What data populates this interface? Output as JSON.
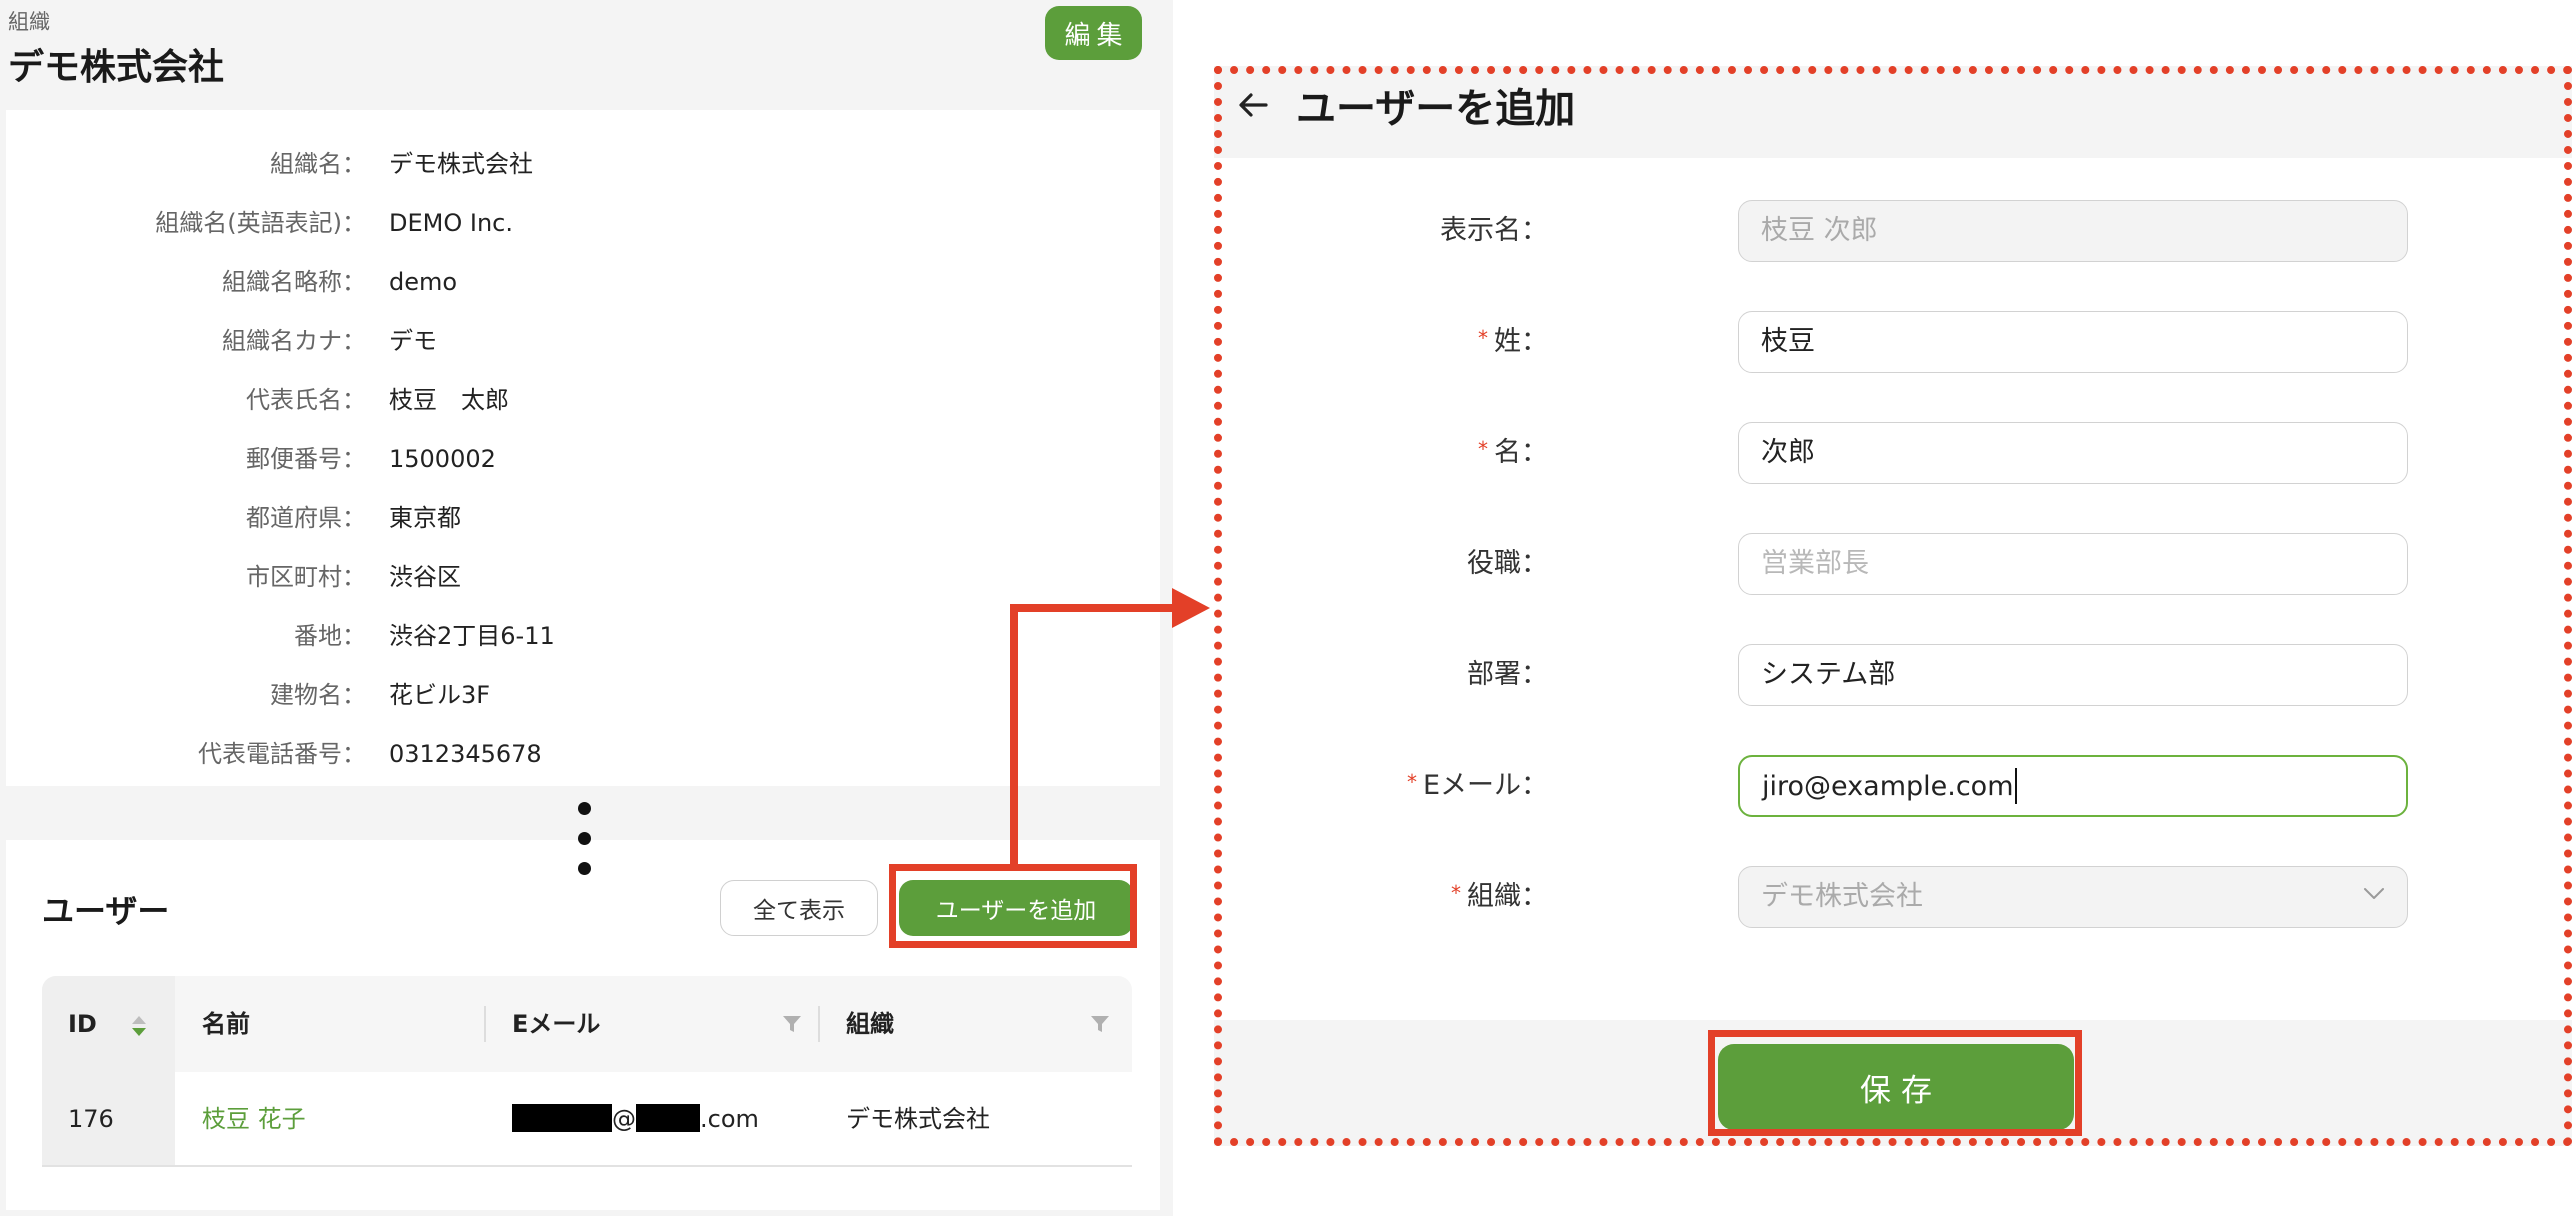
{
  "org": {
    "breadcrumb": "組織",
    "title": "デモ株式会社",
    "edit_label": "編集",
    "fields": [
      {
        "label": "組織名：",
        "value": "デモ株式会社"
      },
      {
        "label": "組織名(英語表記)：",
        "value": "DEMO Inc."
      },
      {
        "label": "組織名略称：",
        "value": "demo"
      },
      {
        "label": "組織名カナ：",
        "value": "デモ"
      },
      {
        "label": "代表氏名：",
        "value": "枝豆　太郎"
      },
      {
        "label": "郵便番号：",
        "value": "1500002"
      },
      {
        "label": "都道府県：",
        "value": "東京都"
      },
      {
        "label": "市区町村：",
        "value": "渋谷区"
      },
      {
        "label": "番地：",
        "value": "渋谷2丁目6-11"
      },
      {
        "label": "建物名：",
        "value": "花ビル3F"
      },
      {
        "label": "代表電話番号：",
        "value": "0312345678"
      }
    ]
  },
  "users": {
    "heading": "ユーザー",
    "show_all_label": "全て表示",
    "add_user_label": "ユーザーを追加",
    "columns": {
      "id": "ID",
      "name": "名前",
      "email": "Eメール",
      "org": "組織"
    },
    "rows": [
      {
        "id": "176",
        "name": "枝豆 花子",
        "email_at": "@",
        "email_tld": "com",
        "org": "デモ株式会社"
      }
    ]
  },
  "form": {
    "title": "ユーザーを追加",
    "required_mark": "*",
    "fields": {
      "display_name": {
        "label": "表示名：",
        "value": "枝豆 次郎",
        "disabled": true
      },
      "last_name": {
        "label": "姓：",
        "value": "枝豆",
        "required": true
      },
      "first_name": {
        "label": "名：",
        "value": "次郎",
        "required": true
      },
      "position": {
        "label": "役職：",
        "placeholder": "営業部長"
      },
      "department": {
        "label": "部署：",
        "value": "システム部"
      },
      "email": {
        "label": "Eメール：",
        "value": "jiro@example.com",
        "required": true,
        "focused": true
      },
      "organization": {
        "label": "組織：",
        "value": "デモ株式会社",
        "required": true,
        "disabled": true
      }
    },
    "save_label": "保存"
  },
  "colors": {
    "brand_green": "#5c9e3b",
    "annotation_red": "#e34028",
    "panel_bg": "#f4f4f4"
  },
  "icons": [
    "sort-icon",
    "filter-icon",
    "back-arrow-icon",
    "chevron-down-icon",
    "vertical-ellipsis-icon"
  ]
}
